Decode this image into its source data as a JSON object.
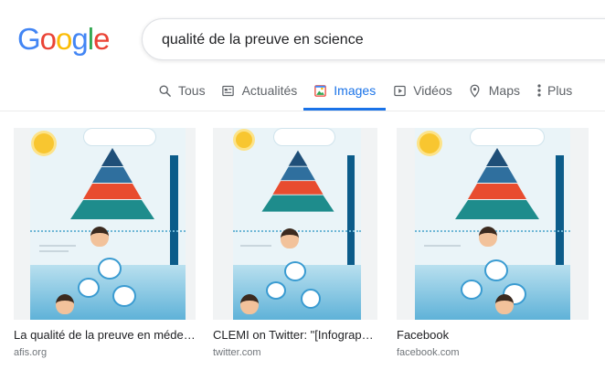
{
  "logo": {
    "text": "Google",
    "letters": [
      "G",
      "o",
      "o",
      "g",
      "l",
      "e"
    ],
    "colors": [
      "#4285F4",
      "#EA4335",
      "#FBBC05",
      "#4285F4",
      "#34A853",
      "#EA4335"
    ]
  },
  "search": {
    "query": "qualité de la preuve en science"
  },
  "tabs": [
    {
      "label": "Tous",
      "icon": "search-icon",
      "active": false
    },
    {
      "label": "Actualités",
      "icon": "news-icon",
      "active": false
    },
    {
      "label": "Images",
      "icon": "image-icon",
      "active": true
    },
    {
      "label": "Vidéos",
      "icon": "video-icon",
      "active": false
    },
    {
      "label": "Maps",
      "icon": "map-pin-icon",
      "active": false
    },
    {
      "label": "Plus",
      "icon": "more-vert-icon",
      "active": false
    }
  ],
  "results": [
    {
      "caption": "La qualité de la preuve en médec...",
      "source": "afis.org"
    },
    {
      "caption": "CLEMI on Twitter: \"[Infographi...",
      "source": "twitter.com"
    },
    {
      "caption": "Facebook",
      "source": "facebook.com"
    }
  ],
  "colors": {
    "accent": "#1a73e8",
    "muted": "#5f6368"
  }
}
